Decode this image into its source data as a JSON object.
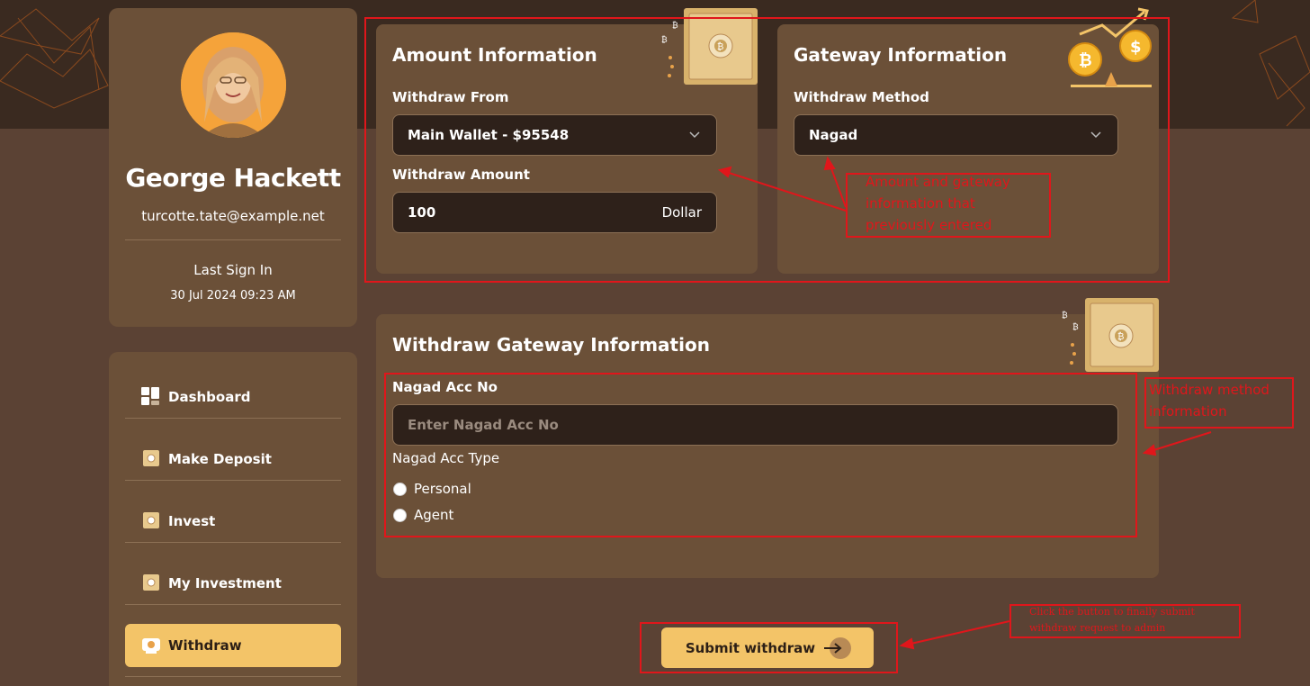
{
  "profile": {
    "name": "George Hackett",
    "email": "turcotte.tate@example.net",
    "last_sign_label": "Last Sign In",
    "last_sign_value": "30 Jul 2024 09:23 AM"
  },
  "nav": {
    "items": [
      {
        "label": "Dashboard",
        "icon": "dashboard-icon",
        "active": false
      },
      {
        "label": "Make Deposit",
        "icon": "safe-icon",
        "active": false
      },
      {
        "label": "Invest",
        "icon": "safe-icon",
        "active": false
      },
      {
        "label": "My Investment",
        "icon": "safe-icon",
        "active": false
      },
      {
        "label": "Withdraw",
        "icon": "withdraw-icon",
        "active": true
      }
    ]
  },
  "amount_info": {
    "title": "Amount Information",
    "withdraw_from_label": "Withdraw From",
    "withdraw_from_value": "Main Wallet - $95548",
    "withdraw_amount_label": "Withdraw Amount",
    "withdraw_amount_value": "100",
    "currency_suffix": "Dollar"
  },
  "gateway_info": {
    "title": "Gateway Information",
    "method_label": "Withdraw Method",
    "method_value": "Nagad"
  },
  "withdraw_gateway": {
    "title": "Withdraw Gateway Information",
    "acc_no_label": "Nagad Acc No",
    "acc_no_placeholder": "Enter Nagad Acc No",
    "acc_type_label": "Nagad Acc Type",
    "options": [
      "Personal",
      "Agent"
    ]
  },
  "submit": {
    "label": "Submit withdraw"
  },
  "annotations": {
    "previous_info": "Amount and gateway information that previously entered",
    "method_info": "Withdraw method information",
    "submit_info": "Click the button to finally submit withdraw request to admin"
  },
  "colors": {
    "accent": "#f3c468",
    "panel": "#6b5038",
    "background": "#5b4234",
    "annotation": "#e0161b"
  }
}
